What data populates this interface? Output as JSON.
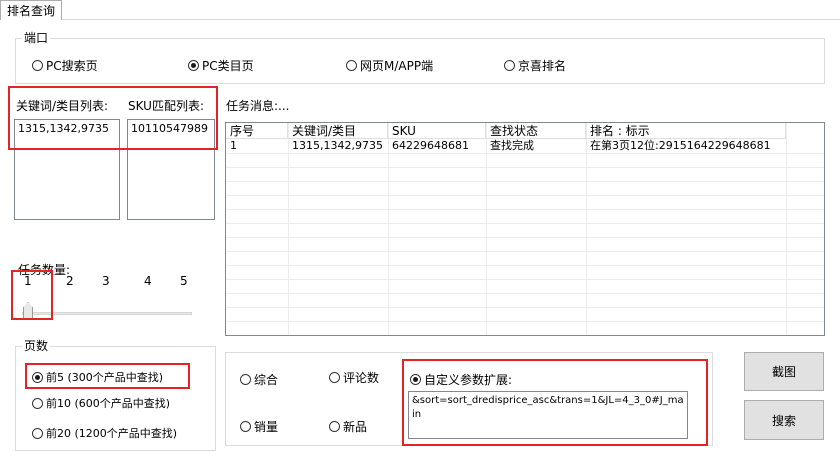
{
  "tab": {
    "label": "排名查询"
  },
  "port_group": {
    "legend": "端口",
    "options": [
      {
        "label": "PC搜索页",
        "selected": false
      },
      {
        "label": "PC类目页",
        "selected": true
      },
      {
        "label": "网页M/APP端",
        "selected": false
      },
      {
        "label": "京喜排名",
        "selected": false
      }
    ]
  },
  "keyword_list": {
    "label": "关键词/类目列表:",
    "items": [
      "1315,1342,9735"
    ]
  },
  "sku_list": {
    "label": "SKU匹配列表:",
    "items": [
      "10110547989"
    ]
  },
  "task_message": {
    "label": "任务消息:..."
  },
  "results_table": {
    "headers": [
      "序号",
      "关键词/类目",
      "SKU",
      "查找状态",
      "排名 : 标示"
    ],
    "rows": [
      [
        "1",
        "1315,1342,9735",
        "64229648681",
        "查找完成",
        "在第3页12位:2915164229648681"
      ]
    ]
  },
  "task_count": {
    "label": "任务数量:",
    "ticks": [
      "1",
      "2",
      "3",
      "4",
      "5"
    ],
    "value": 1
  },
  "pages_group": {
    "legend": "页数",
    "options": [
      {
        "label": "前5 (300个产品中查找)",
        "selected": true
      },
      {
        "label": "前10 (600个产品中查找)",
        "selected": false
      },
      {
        "label": "前20 (1200个产品中查找)",
        "selected": false
      }
    ]
  },
  "sort_group": {
    "options": [
      {
        "label": "综合",
        "selected": false
      },
      {
        "label": "评论数",
        "selected": false
      },
      {
        "label": "销量",
        "selected": false
      },
      {
        "label": "新品",
        "selected": false
      }
    ],
    "custom": {
      "label": "自定义参数扩展:",
      "selected": true,
      "value": "&sort=sort_dredisprice_asc&trans=1&JL=4_3_0#J_main"
    }
  },
  "buttons": {
    "screenshot": "截图",
    "search": "搜索"
  }
}
